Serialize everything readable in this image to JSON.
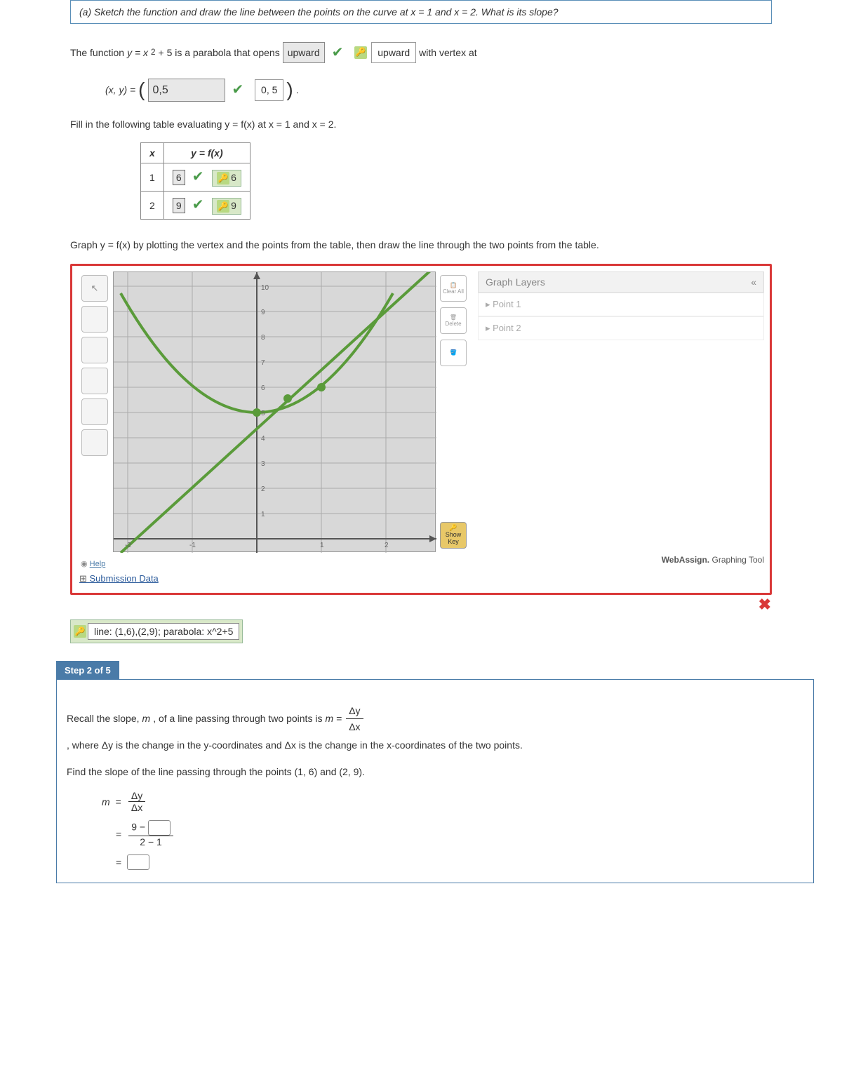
{
  "question_a": "(a) Sketch the function and draw the line between the points on the curve at x = 1 and x = 2. What is its slope?",
  "func_text_pre": "The function ",
  "func_eq": "y = x",
  "func_sq": "2",
  "func_post": " + 5 is a parabola that opens ",
  "upward_input": "upward",
  "upward_answer": "upward",
  "vertex_text": " with vertex at",
  "vertex_label": "(x, y) = ",
  "vertex_input": "0,5",
  "vertex_answer": "0, 5",
  "vertex_end": ".",
  "fill_text": "Fill in the following table evaluating y = f(x) at x = 1 and x = 2.",
  "table": {
    "h1": "x",
    "h2": "y = f(x)",
    "rows": [
      {
        "x": "1",
        "input": "6",
        "answer": "6"
      },
      {
        "x": "2",
        "input": "9",
        "answer": "9"
      }
    ]
  },
  "graph_instr": "Graph y = f(x) by plotting the vertex and the points from the table, then draw the line through the two points from the table.",
  "layers_header": "Graph Layers",
  "layers": {
    "p1": "Point 1",
    "p2": "Point 2"
  },
  "tools": {
    "clear": "Clear All",
    "delete": "Delete",
    "showkey": "Show Key"
  },
  "graph_footer": "WebAssign. Graphing Tool",
  "help": "Help",
  "submission": "Submission Data",
  "graph_answer": "line: (1,6),(2,9); parabola: x^2+5",
  "step_label": "Step 2 of 5",
  "step2_text1_pre": "Recall the slope, ",
  "step2_text1_m": "m",
  "step2_text1_mid": ", of a line passing through two points is ",
  "step2_text1_eq": "m = ",
  "step2_frac_num": "Δy",
  "step2_frac_den": "Δx",
  "step2_text1_post": ", where Δy is the change in the y-coordinates and Δx is the change in the x-coordinates of the two points.",
  "step2_text2": "Find the slope of the line passing through the points (1, 6) and (2, 9).",
  "slope_m": "m",
  "slope_eq": "=",
  "slope_num2": "9 −",
  "slope_den2": "2 − 1",
  "chart_data": {
    "type": "line",
    "title": "",
    "xlabel": "",
    "ylabel": "",
    "xlim": [
      -2.5,
      2.5
    ],
    "ylim": [
      -1,
      10
    ],
    "series": [
      {
        "name": "parabola y=x^2+5",
        "x": [
          -2.2,
          -2,
          -1.5,
          -1,
          -0.5,
          0,
          0.5,
          1,
          1.5,
          2,
          2.2
        ],
        "values": [
          9.84,
          9,
          7.25,
          6,
          5.25,
          5,
          5.25,
          6,
          7.25,
          9,
          9.84
        ]
      },
      {
        "name": "secant line",
        "x": [
          -2.2,
          2.5
        ],
        "values": [
          -3.6,
          10.5
        ]
      }
    ],
    "points": [
      {
        "x": 0,
        "y": 5
      },
      {
        "x": 1,
        "y": 6
      },
      {
        "x": 2,
        "y": 9
      }
    ]
  }
}
